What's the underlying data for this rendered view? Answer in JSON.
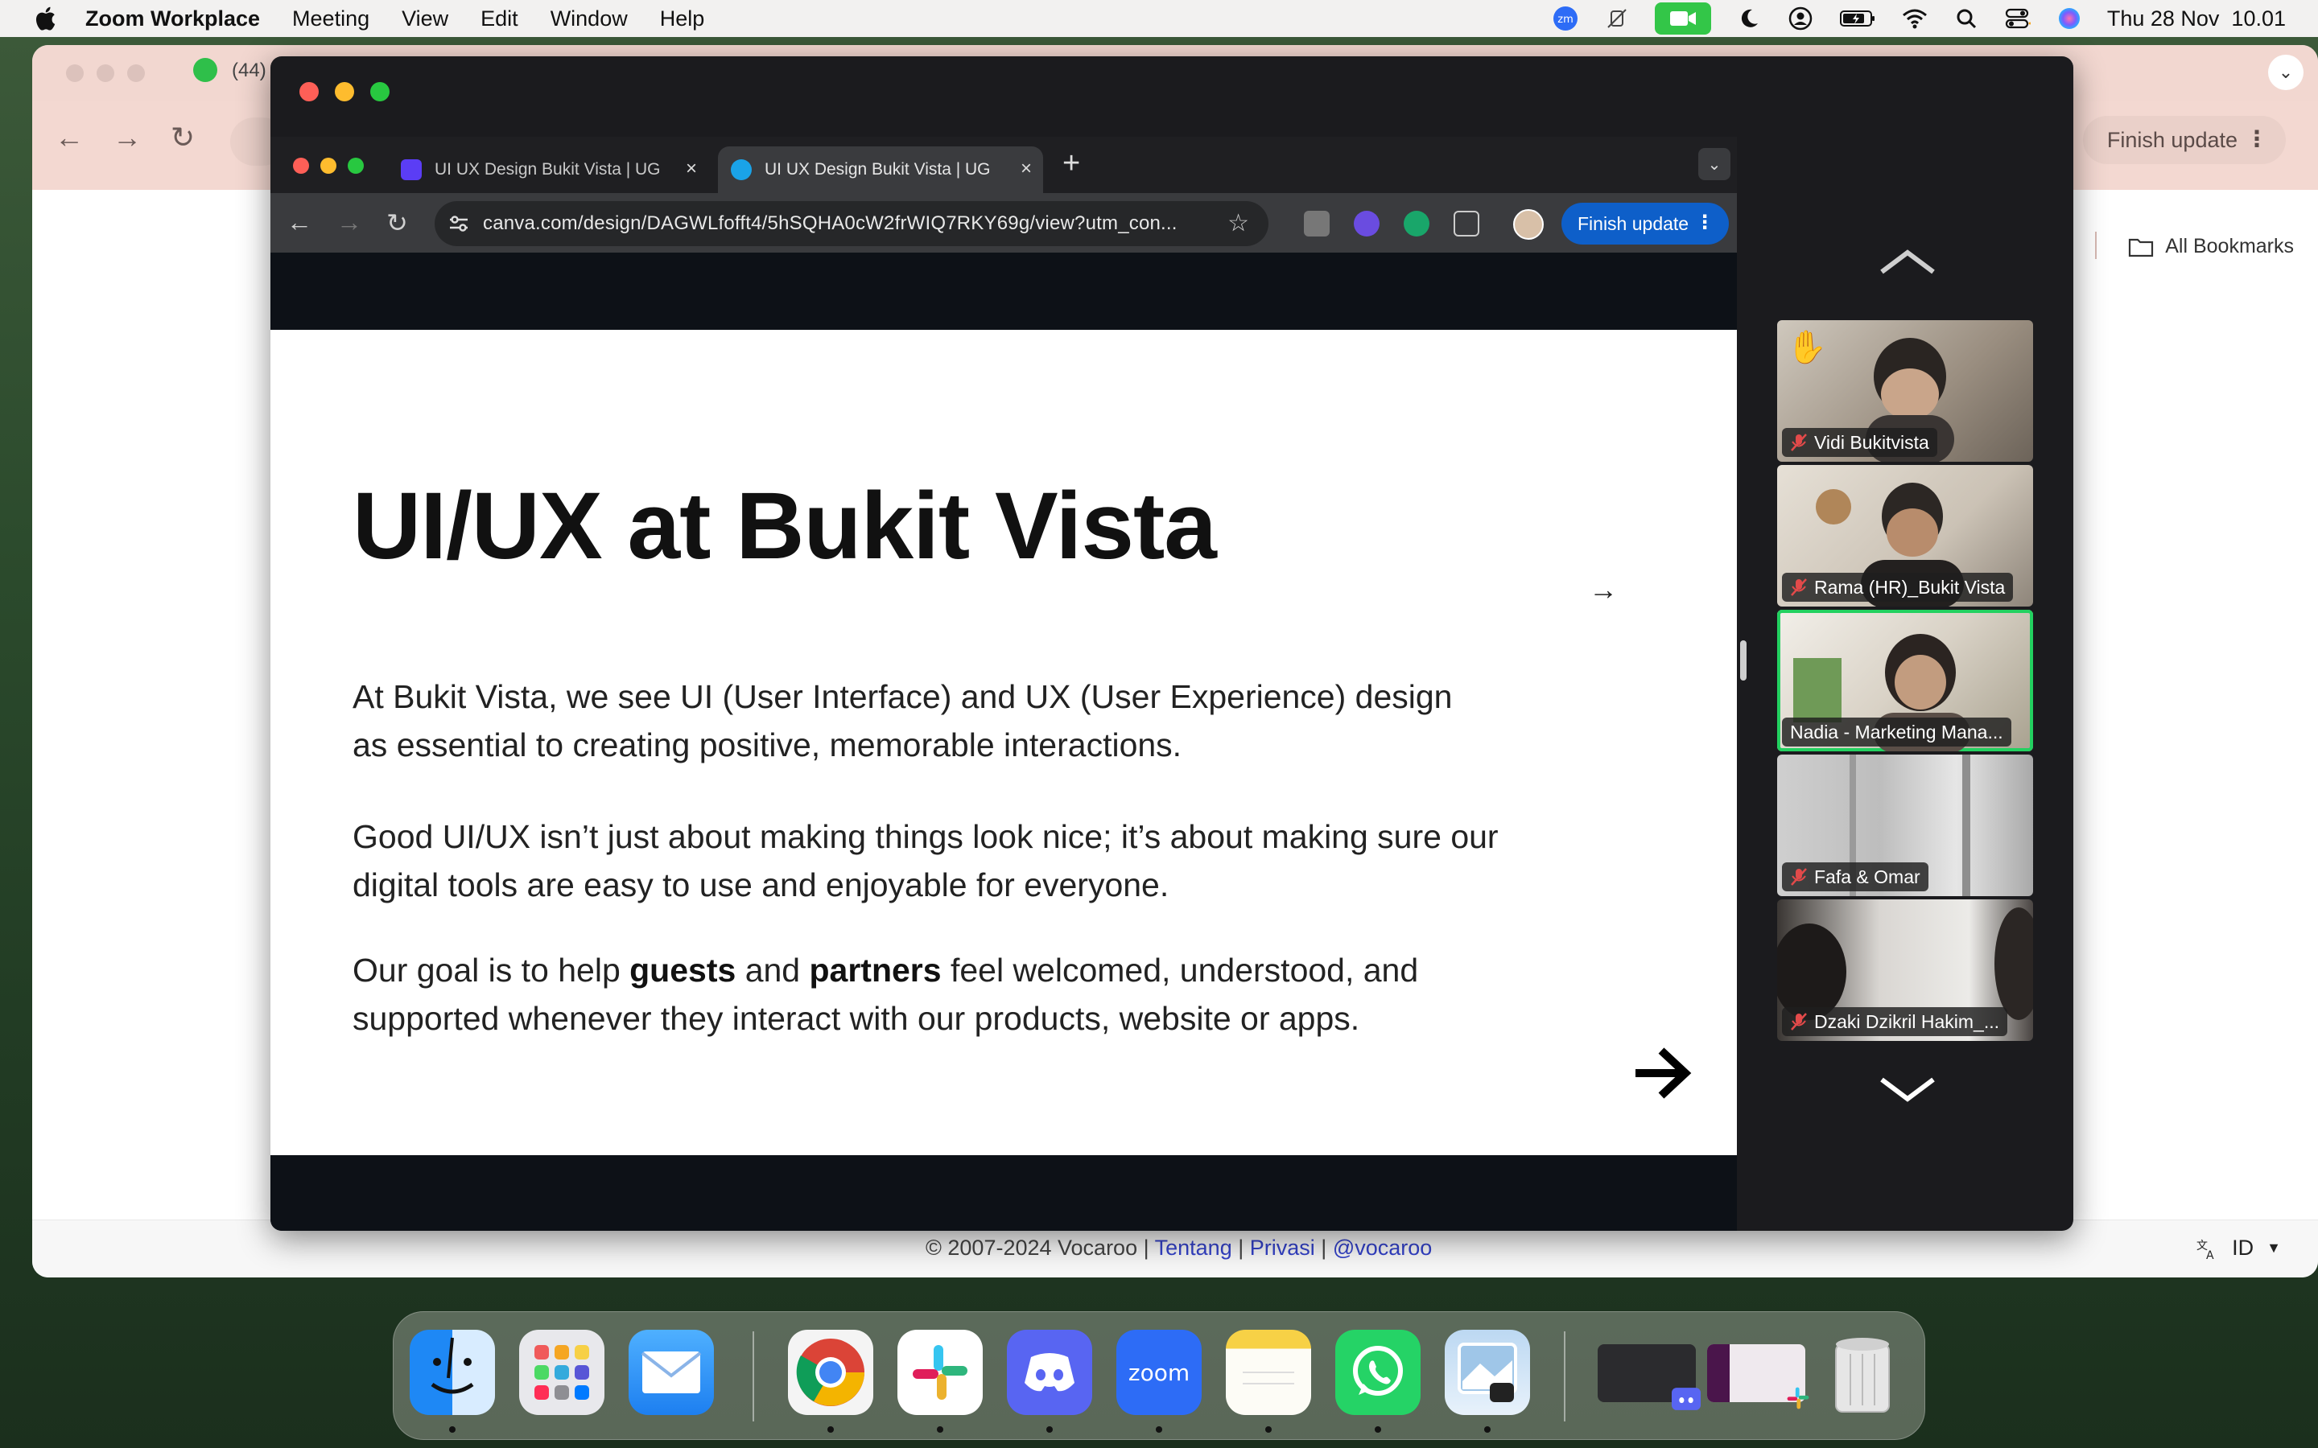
{
  "menubar": {
    "app_name": "Zoom Workplace",
    "menus": [
      "Meeting",
      "View",
      "Edit",
      "Window",
      "Help"
    ],
    "clock": "Thu 28 Nov  10.01"
  },
  "background_browser": {
    "tab_label": "(44)",
    "finish_update": "Finish update",
    "bookmarks": "All Bookmarks",
    "footer": {
      "copyright": "© 2007-2024 Vocaroo |",
      "link_about": "Tentang",
      "sep": "|",
      "link_privacy": "Privasi",
      "link_handle": "@vocaroo"
    },
    "language": "ID"
  },
  "shared_screen": {
    "tabs": [
      {
        "label": "UI UX Design Bukit Vista | UG"
      },
      {
        "label": "UI UX Design Bukit Vista | UG"
      }
    ],
    "url": "canva.com/design/DAGWLfofft4/5hSQHA0cW2frWIQ7RKY69g/view?utm_con...",
    "finish_update": "Finish update",
    "slide": {
      "title": "UI/UX at Bukit Vista",
      "para1": "At Bukit Vista, we see UI (User Interface) and UX (User Experience) design as essential to creating positive, memorable interactions.",
      "para2": "Good UI/UX isn’t just about making things look nice; it’s about making sure our digital tools are easy to use and enjoyable for everyone.",
      "para3_a": "Our goal is to help ",
      "para3_b": "guests",
      "para3_c": " and ",
      "para3_d": "partners",
      "para3_e": " feel welcomed, understood, and supported whenever they interact with our products, website or apps.",
      "arrow_small": "→"
    }
  },
  "participants": [
    {
      "name": "Vidi Bukitvista",
      "hand_raised": true,
      "muted": true,
      "active": false
    },
    {
      "name": "Rama (HR)_Bukit Vista",
      "hand_raised": false,
      "muted": true,
      "active": false
    },
    {
      "name": "Nadia - Marketing Mana...",
      "hand_raised": false,
      "muted": false,
      "active": true
    },
    {
      "name": "Fafa & Omar",
      "hand_raised": false,
      "muted": true,
      "active": false
    },
    {
      "name": "Dzaki Dzikril Hakim_...",
      "hand_raised": false,
      "muted": true,
      "active": false
    }
  ],
  "dock": {
    "zoom_label": "zoom",
    "apps": [
      "finder",
      "launchpad",
      "mail",
      "chrome",
      "slack",
      "discord",
      "zoom",
      "notes",
      "whatsapp",
      "preview",
      "window-preview-1",
      "window-preview-2",
      "trash"
    ]
  }
}
